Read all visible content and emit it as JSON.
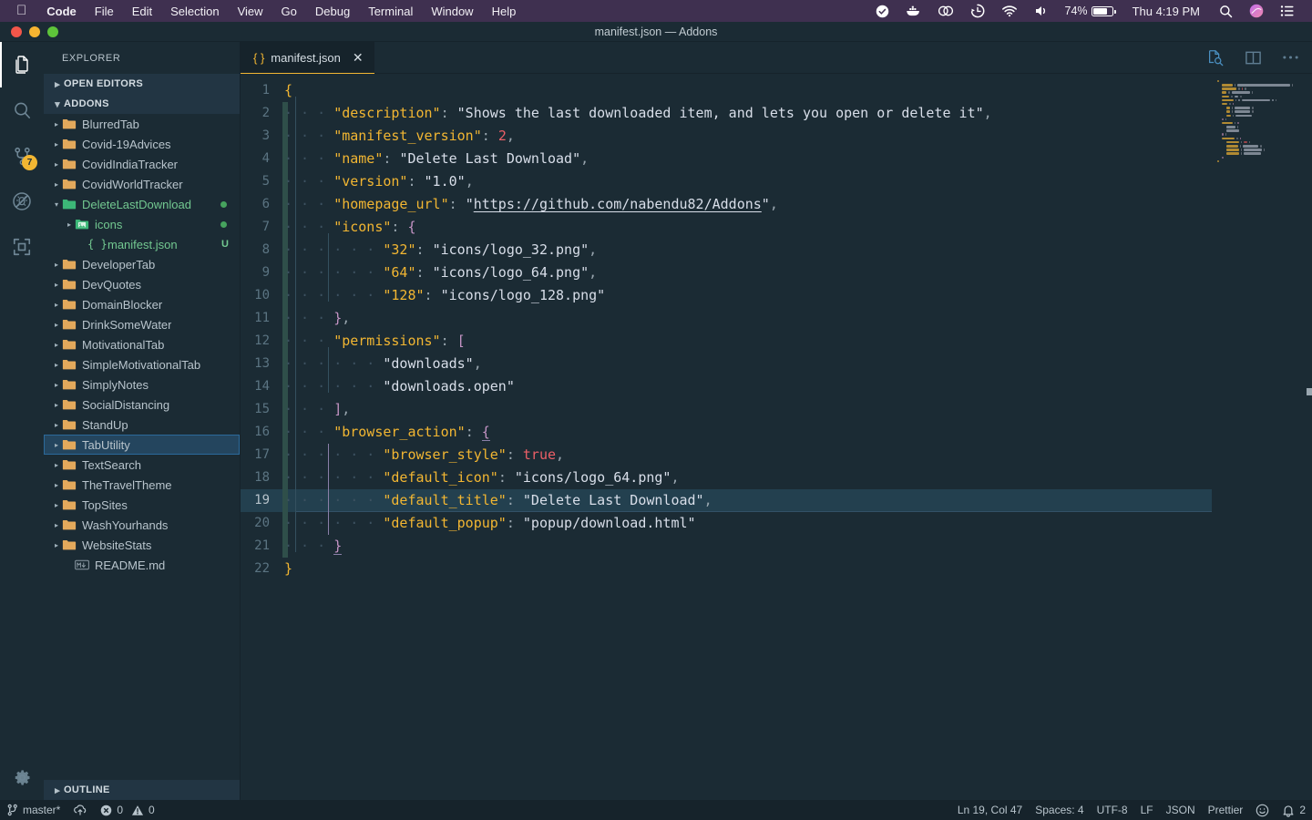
{
  "menubar": {
    "apple_icon": "apple-logo-icon",
    "items": [
      {
        "label": "Code",
        "bold": true
      },
      {
        "label": "File",
        "bold": false
      },
      {
        "label": "Edit",
        "bold": false
      },
      {
        "label": "Selection",
        "bold": false
      },
      {
        "label": "View",
        "bold": false
      },
      {
        "label": "Go",
        "bold": false
      },
      {
        "label": "Debug",
        "bold": false
      },
      {
        "label": "Terminal",
        "bold": false
      },
      {
        "label": "Window",
        "bold": false
      },
      {
        "label": "Help",
        "bold": false
      }
    ],
    "status_icons": [
      "checkmark-circle-icon",
      "docker-whale-icon",
      "cloud-sync-icon",
      "time-machine-icon",
      "wifi-icon",
      "volume-icon"
    ],
    "battery_percent": "74%",
    "clock": "Thu 4:19 PM",
    "right_icons": [
      "spotlight-search-icon",
      "siri-icon",
      "control-center-icon"
    ]
  },
  "titlebar": {
    "title": "manifest.json — Addons",
    "traffic_lights": [
      "close-button",
      "minimize-button",
      "zoom-button"
    ]
  },
  "activitybar": {
    "items": [
      {
        "name": "explorer",
        "icon": "files-icon",
        "active": true,
        "badge": ""
      },
      {
        "name": "search",
        "icon": "search-icon",
        "active": false,
        "badge": ""
      },
      {
        "name": "source-control",
        "icon": "source-control-icon",
        "active": false,
        "badge": "7"
      },
      {
        "name": "debug",
        "icon": "debug-icon",
        "active": false,
        "badge": ""
      },
      {
        "name": "extensions",
        "icon": "extensions-icon",
        "active": false,
        "badge": ""
      }
    ],
    "settings": {
      "name": "manage",
      "icon": "gear-icon"
    }
  },
  "sidebar": {
    "title": "EXPLORER",
    "open_editors": {
      "label": "OPEN EDITORS",
      "expanded": false
    },
    "addons": {
      "label": "ADDONS",
      "expanded": true
    },
    "outline": {
      "label": "OUTLINE",
      "expanded": false
    },
    "tree": [
      {
        "label": "BlurredTab",
        "type": "folder",
        "indent": 1,
        "expanded": false,
        "status": "",
        "selected": false
      },
      {
        "label": "Covid-19Advices",
        "type": "folder",
        "indent": 1,
        "expanded": false,
        "status": "",
        "selected": false
      },
      {
        "label": "CovidIndiaTracker",
        "type": "folder",
        "indent": 1,
        "expanded": false,
        "status": "",
        "selected": false
      },
      {
        "label": "CovidWorldTracker",
        "type": "folder",
        "indent": 1,
        "expanded": false,
        "status": "",
        "selected": false
      },
      {
        "label": "DeleteLastDownload",
        "type": "folder",
        "indent": 1,
        "expanded": true,
        "status": "dot",
        "selected": false,
        "modified": true
      },
      {
        "label": "icons",
        "type": "imgfolder",
        "indent": 2,
        "expanded": false,
        "status": "dot",
        "selected": false,
        "modified": true
      },
      {
        "label": "manifest.json",
        "type": "json",
        "indent": 3,
        "expanded": null,
        "status": "U",
        "selected": false,
        "modified": true
      },
      {
        "label": "DeveloperTab",
        "type": "folder",
        "indent": 1,
        "expanded": false,
        "status": "",
        "selected": false
      },
      {
        "label": "DevQuotes",
        "type": "folder",
        "indent": 1,
        "expanded": false,
        "status": "",
        "selected": false
      },
      {
        "label": "DomainBlocker",
        "type": "folder",
        "indent": 1,
        "expanded": false,
        "status": "",
        "selected": false
      },
      {
        "label": "DrinkSomeWater",
        "type": "folder",
        "indent": 1,
        "expanded": false,
        "status": "",
        "selected": false
      },
      {
        "label": "MotivationalTab",
        "type": "folder",
        "indent": 1,
        "expanded": false,
        "status": "",
        "selected": false
      },
      {
        "label": "SimpleMotivationalTab",
        "type": "folder",
        "indent": 1,
        "expanded": false,
        "status": "",
        "selected": false
      },
      {
        "label": "SimplyNotes",
        "type": "folder",
        "indent": 1,
        "expanded": false,
        "status": "",
        "selected": false
      },
      {
        "label": "SocialDistancing",
        "type": "folder",
        "indent": 1,
        "expanded": false,
        "status": "",
        "selected": false
      },
      {
        "label": "StandUp",
        "type": "folder",
        "indent": 1,
        "expanded": false,
        "status": "",
        "selected": false
      },
      {
        "label": "TabUtility",
        "type": "folder",
        "indent": 1,
        "expanded": false,
        "status": "",
        "selected": true
      },
      {
        "label": "TextSearch",
        "type": "folder",
        "indent": 1,
        "expanded": false,
        "status": "",
        "selected": false
      },
      {
        "label": "TheTravelTheme",
        "type": "folder",
        "indent": 1,
        "expanded": false,
        "status": "",
        "selected": false
      },
      {
        "label": "TopSites",
        "type": "folder",
        "indent": 1,
        "expanded": false,
        "status": "",
        "selected": false
      },
      {
        "label": "WashYourhands",
        "type": "folder",
        "indent": 1,
        "expanded": false,
        "status": "",
        "selected": false
      },
      {
        "label": "WebsiteStats",
        "type": "folder",
        "indent": 1,
        "expanded": false,
        "status": "",
        "selected": false
      },
      {
        "label": "README.md",
        "type": "md",
        "indent": 2,
        "expanded": null,
        "status": "",
        "selected": false
      }
    ]
  },
  "editor": {
    "tab": {
      "label": "manifest.json",
      "icon": "json-braces-icon",
      "close_icon": "close-icon",
      "active": true
    },
    "actions": [
      {
        "name": "open-preview",
        "icon": "preview-icon"
      },
      {
        "name": "split-editor",
        "icon": "split-editor-icon"
      },
      {
        "name": "more-actions",
        "icon": "ellipsis-icon"
      }
    ],
    "current_line": 19,
    "total_lines": 22,
    "file_text": "{\n    \"description\": \"Shows the last downloaded item, and lets you open or delete it\",\n    \"manifest_version\": 2,\n    \"name\": \"Delete Last Download\",\n    \"version\": \"1.0\",\n    \"homepage_url\": \"https://github.com/nabendu82/Addons\",\n    \"icons\": {\n        \"32\": \"icons/logo_32.png\",\n        \"64\": \"icons/logo_64.png\",\n        \"128\": \"icons/logo_128.png\"\n    },\n    \"permissions\": [\n        \"downloads\",\n        \"downloads.open\"\n    ],\n    \"browser_action\": {\n        \"browser_style\": true,\n        \"default_icon\": \"icons/logo_64.png\",\n        \"default_title\": \"Delete Last Download\",\n        \"default_popup\": \"popup/download.html\"\n    }\n}",
    "lines": [
      {
        "n": 1,
        "indent": 0,
        "modified": false,
        "tokens": [
          {
            "t": "brace",
            "v": "{"
          }
        ]
      },
      {
        "n": 2,
        "indent": 1,
        "modified": true,
        "tokens": [
          {
            "t": "key",
            "v": "\"description\""
          },
          {
            "t": "col",
            "v": ":"
          },
          {
            "t": "sp",
            "v": " "
          },
          {
            "t": "str",
            "v": "\"Shows the last downloaded item, and lets you open or delete it\""
          },
          {
            "t": "col",
            "v": ","
          }
        ]
      },
      {
        "n": 3,
        "indent": 1,
        "modified": true,
        "tokens": [
          {
            "t": "key",
            "v": "\"manifest_version\""
          },
          {
            "t": "col",
            "v": ":"
          },
          {
            "t": "sp",
            "v": " "
          },
          {
            "t": "num",
            "v": "2"
          },
          {
            "t": "col",
            "v": ","
          }
        ]
      },
      {
        "n": 4,
        "indent": 1,
        "modified": true,
        "tokens": [
          {
            "t": "key",
            "v": "\"name\""
          },
          {
            "t": "col",
            "v": ":"
          },
          {
            "t": "sp",
            "v": " "
          },
          {
            "t": "str",
            "v": "\"Delete Last Download\""
          },
          {
            "t": "col",
            "v": ","
          }
        ]
      },
      {
        "n": 5,
        "indent": 1,
        "modified": true,
        "tokens": [
          {
            "t": "key",
            "v": "\"version\""
          },
          {
            "t": "col",
            "v": ":"
          },
          {
            "t": "sp",
            "v": " "
          },
          {
            "t": "str",
            "v": "\"1.0\""
          },
          {
            "t": "col",
            "v": ","
          }
        ]
      },
      {
        "n": 6,
        "indent": 1,
        "modified": true,
        "tokens": [
          {
            "t": "key",
            "v": "\"homepage_url\""
          },
          {
            "t": "col",
            "v": ":"
          },
          {
            "t": "sp",
            "v": " "
          },
          {
            "t": "str",
            "v": "\""
          },
          {
            "t": "link",
            "v": "https://github.com/nabendu82/Addons"
          },
          {
            "t": "str",
            "v": "\""
          },
          {
            "t": "col",
            "v": ","
          }
        ]
      },
      {
        "n": 7,
        "indent": 1,
        "modified": true,
        "tokens": [
          {
            "t": "key",
            "v": "\"icons\""
          },
          {
            "t": "col",
            "v": ":"
          },
          {
            "t": "sp",
            "v": " "
          },
          {
            "t": "punc",
            "v": "{"
          }
        ]
      },
      {
        "n": 8,
        "indent": 2,
        "modified": true,
        "tokens": [
          {
            "t": "key",
            "v": "\"32\""
          },
          {
            "t": "col",
            "v": ":"
          },
          {
            "t": "sp",
            "v": " "
          },
          {
            "t": "str",
            "v": "\"icons/logo_32.png\""
          },
          {
            "t": "col",
            "v": ","
          }
        ]
      },
      {
        "n": 9,
        "indent": 2,
        "modified": true,
        "tokens": [
          {
            "t": "key",
            "v": "\"64\""
          },
          {
            "t": "col",
            "v": ":"
          },
          {
            "t": "sp",
            "v": " "
          },
          {
            "t": "str",
            "v": "\"icons/logo_64.png\""
          },
          {
            "t": "col",
            "v": ","
          }
        ]
      },
      {
        "n": 10,
        "indent": 2,
        "modified": true,
        "tokens": [
          {
            "t": "key",
            "v": "\"128\""
          },
          {
            "t": "col",
            "v": ":"
          },
          {
            "t": "sp",
            "v": " "
          },
          {
            "t": "str",
            "v": "\"icons/logo_128.png\""
          }
        ]
      },
      {
        "n": 11,
        "indent": 1,
        "modified": true,
        "tokens": [
          {
            "t": "punc",
            "v": "}"
          },
          {
            "t": "col",
            "v": ","
          }
        ]
      },
      {
        "n": 12,
        "indent": 1,
        "modified": true,
        "tokens": [
          {
            "t": "key",
            "v": "\"permissions\""
          },
          {
            "t": "col",
            "v": ":"
          },
          {
            "t": "sp",
            "v": " "
          },
          {
            "t": "punc",
            "v": "["
          }
        ]
      },
      {
        "n": 13,
        "indent": 2,
        "modified": true,
        "tokens": [
          {
            "t": "str",
            "v": "\"downloads\""
          },
          {
            "t": "col",
            "v": ","
          }
        ]
      },
      {
        "n": 14,
        "indent": 2,
        "modified": true,
        "tokens": [
          {
            "t": "str",
            "v": "\"downloads.open\""
          }
        ]
      },
      {
        "n": 15,
        "indent": 1,
        "modified": true,
        "tokens": [
          {
            "t": "punc",
            "v": "]"
          },
          {
            "t": "col",
            "v": ","
          }
        ]
      },
      {
        "n": 16,
        "indent": 1,
        "modified": true,
        "tokens": [
          {
            "t": "key",
            "v": "\"browser_action\""
          },
          {
            "t": "col",
            "v": ":"
          },
          {
            "t": "sp",
            "v": " "
          },
          {
            "t": "match",
            "v": "{"
          }
        ]
      },
      {
        "n": 17,
        "indent": 2,
        "modified": true,
        "tokens": [
          {
            "t": "key",
            "v": "\"browser_style\""
          },
          {
            "t": "col",
            "v": ":"
          },
          {
            "t": "sp",
            "v": " "
          },
          {
            "t": "bool",
            "v": "true"
          },
          {
            "t": "col",
            "v": ","
          }
        ]
      },
      {
        "n": 18,
        "indent": 2,
        "modified": true,
        "tokens": [
          {
            "t": "key",
            "v": "\"default_icon\""
          },
          {
            "t": "col",
            "v": ":"
          },
          {
            "t": "sp",
            "v": " "
          },
          {
            "t": "str",
            "v": "\"icons/logo_64.png\""
          },
          {
            "t": "col",
            "v": ","
          }
        ]
      },
      {
        "n": 19,
        "indent": 2,
        "modified": true,
        "current": true,
        "tokens": [
          {
            "t": "key",
            "v": "\"default_title\""
          },
          {
            "t": "col",
            "v": ":"
          },
          {
            "t": "sp",
            "v": " "
          },
          {
            "t": "str",
            "v": "\"Delete Last Download\""
          },
          {
            "t": "col",
            "v": ","
          }
        ]
      },
      {
        "n": 20,
        "indent": 2,
        "modified": true,
        "tokens": [
          {
            "t": "key",
            "v": "\"default_popup\""
          },
          {
            "t": "col",
            "v": ":"
          },
          {
            "t": "sp",
            "v": " "
          },
          {
            "t": "str",
            "v": "\"popup/download.html\""
          }
        ]
      },
      {
        "n": 21,
        "indent": 1,
        "modified": true,
        "tokens": [
          {
            "t": "match",
            "v": "}"
          }
        ]
      },
      {
        "n": 22,
        "indent": 0,
        "modified": false,
        "tokens": [
          {
            "t": "brace",
            "v": "}"
          }
        ]
      }
    ]
  },
  "statusbar": {
    "branch": "master*",
    "branch_icon": "git-branch-icon",
    "sync_icon": "sync-cloud-icon",
    "error_icon": "error-circle-icon",
    "errors": "0",
    "warning_icon": "warning-triangle-icon",
    "warnings": "0",
    "position": "Ln 19, Col 47",
    "spaces": "Spaces: 4",
    "encoding": "UTF-8",
    "eol": "LF",
    "language": "JSON",
    "formatter": "Prettier",
    "feedback_icon": "smiley-icon",
    "bell_icon": "bell-icon",
    "notifications": "2"
  },
  "colors": {
    "menubar_bg": "#3f3050",
    "editor_bg": "#1b2b34",
    "tab_active_bg": "#16232b",
    "tab_accent": "#f2b632",
    "key_color": "#f2b632",
    "string_color": "#d8dee9",
    "number_color": "#ec5f67",
    "punct_color": "#c594c5",
    "git_modified": "#73c991",
    "selection_bg": "#24455e",
    "badge_bg": "#f2b632"
  }
}
